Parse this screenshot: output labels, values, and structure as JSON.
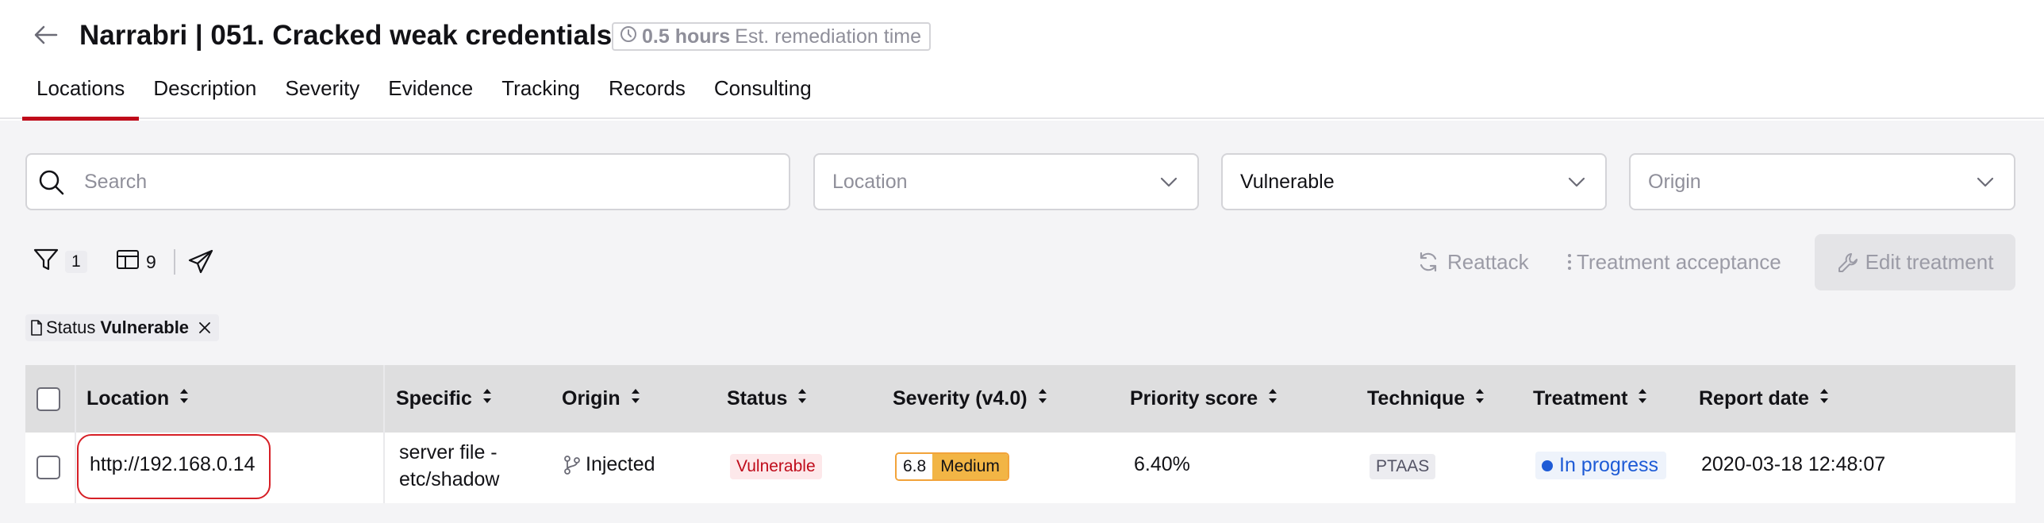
{
  "header": {
    "title": "Narrabri | 051. Cracked weak credentials",
    "time_value": "0.5 hours",
    "time_label": "Est. remediation time",
    "tabs": [
      "Locations",
      "Description",
      "Severity",
      "Evidence",
      "Tracking",
      "Records",
      "Consulting"
    ],
    "active_tab": "Locations"
  },
  "filters": {
    "search_placeholder": "Search",
    "location_placeholder": "Location",
    "status_value": "Vulnerable",
    "origin_placeholder": "Origin"
  },
  "toolbar": {
    "filter_count": "1",
    "columns_count": "9",
    "reattack_label": "Reattack",
    "treatment_acceptance_label": "Treatment acceptance",
    "edit_treatment_label": "Edit treatment"
  },
  "active_filter": {
    "label": "Status",
    "value": "Vulnerable"
  },
  "table": {
    "columns": [
      "Location",
      "Specific",
      "Origin",
      "Status",
      "Severity (v4.0)",
      "Priority score",
      "Technique",
      "Treatment",
      "Report date"
    ],
    "rows": [
      {
        "location": "http://192.168.0.14",
        "specific_line1": "server file -",
        "specific_line2": "etc/shadow",
        "origin": "Injected",
        "status": "Vulnerable",
        "severity_score": "6.8",
        "severity_level": "Medium",
        "priority_score": "6.40%",
        "technique": "PTAAS",
        "treatment": "In progress",
        "report_date": "2020-03-18 12:48:07"
      }
    ]
  },
  "colors": {
    "accent": "#bf0b1a",
    "medium": "#f2b545",
    "in_progress": "#1e5bd6"
  }
}
